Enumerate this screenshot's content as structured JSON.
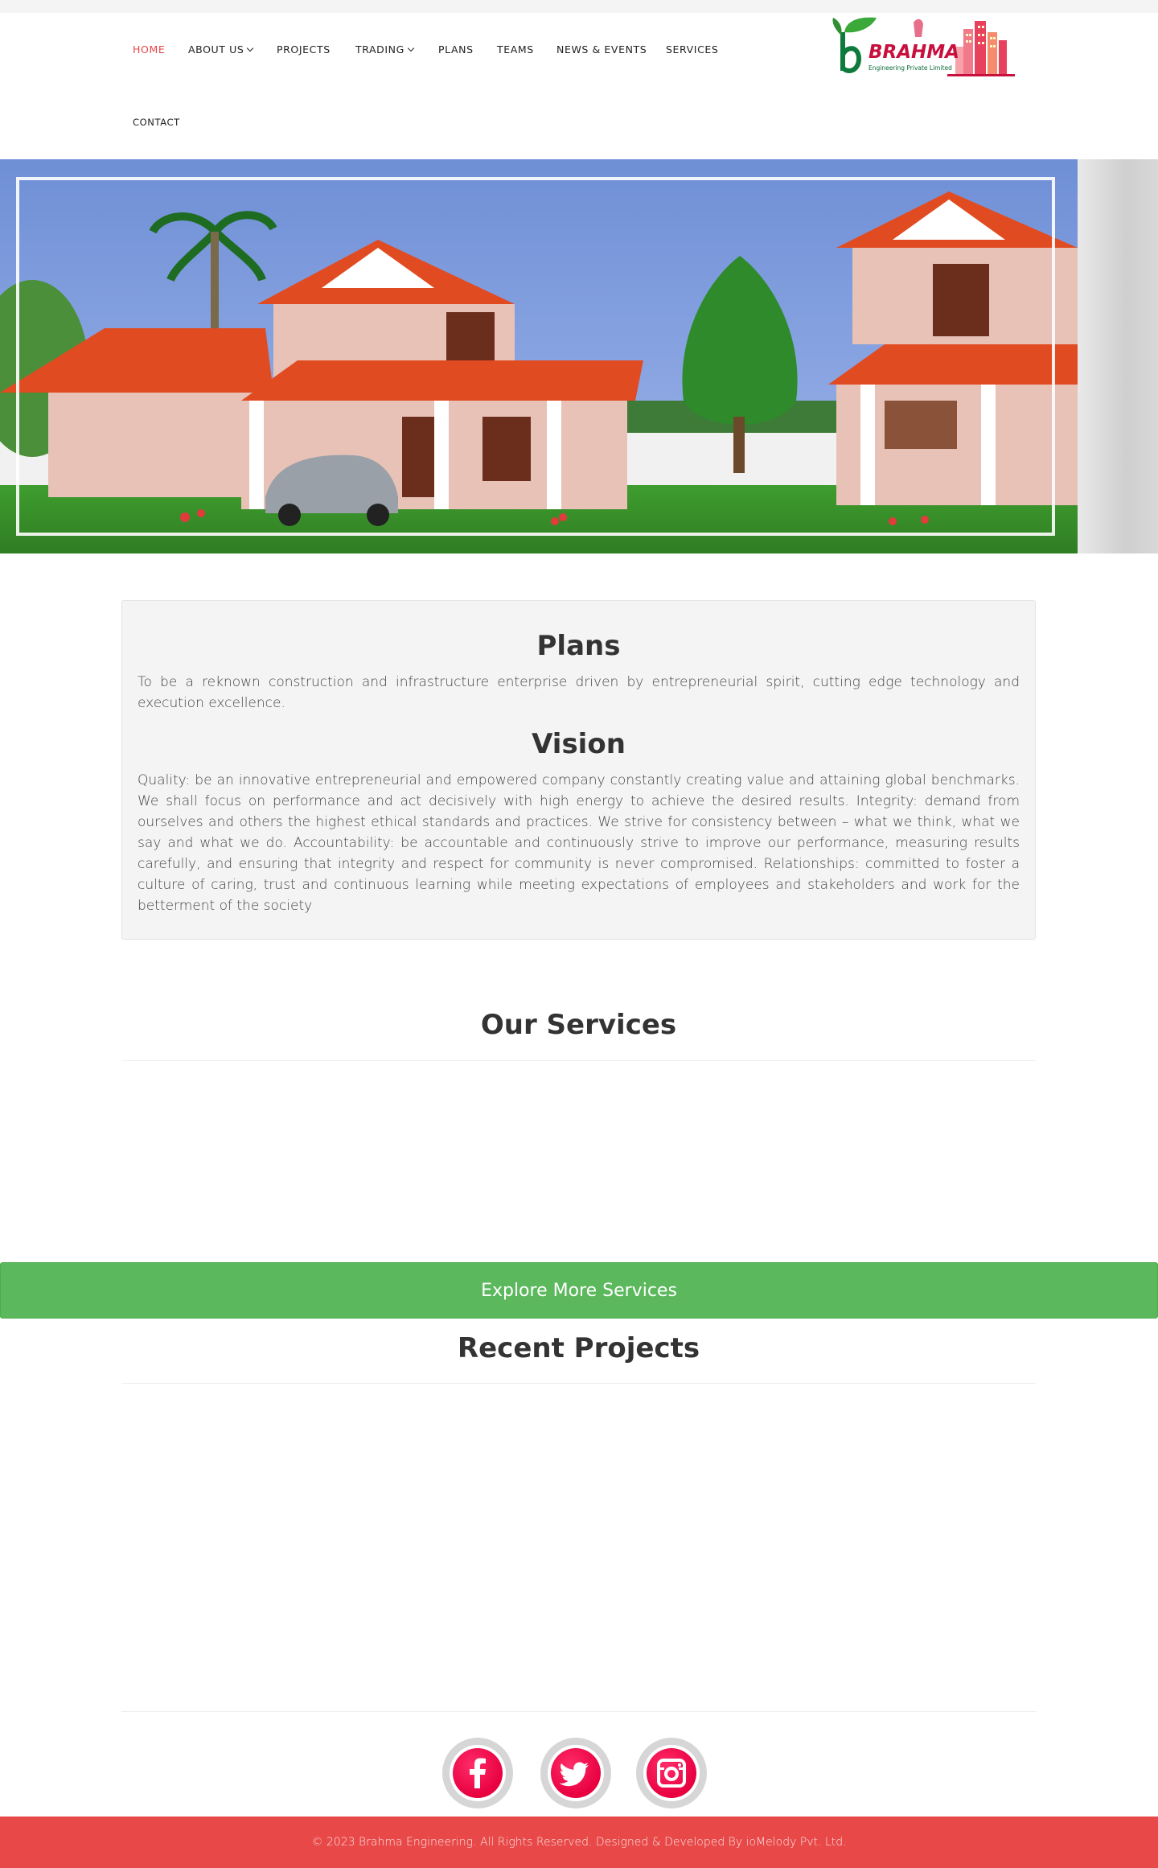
{
  "nav": {
    "items": [
      {
        "label": "HOME",
        "active": true
      },
      {
        "label": "ABOUT US",
        "dropdown": true
      },
      {
        "label": "PROJECTS"
      },
      {
        "label": "TRADING",
        "dropdown": true
      },
      {
        "label": "PLANS"
      },
      {
        "label": "TEAMS"
      },
      {
        "label": "NEWS & EVENTS"
      },
      {
        "label": "SERVICES"
      },
      {
        "label": "CONTACT"
      }
    ],
    "active_color": "#e84545"
  },
  "logo": {
    "name": "BRAHMA",
    "subtitle": "Engineering Private Limited"
  },
  "plans_box": {
    "plans_heading": "Plans",
    "plans_text": "To be a reknown construction and infrastructure enterprise driven by entrepreneurial spirit, cutting edge technology and execution excellence.",
    "vision_heading": "Vision",
    "vision_text": "Quality: be an innovative entrepreneurial and empowered company constantly creating value and attaining global benchmarks. We shall focus on performance and act decisively with high energy to achieve the desired results. Integrity: demand from ourselves and others the highest ethical standards and practices. We strive for consistency between – what we think, what we say and what we do. Accountability: be accountable and continuously strive to improve our performance, measuring results carefully, and ensuring that integrity and respect for community is never compromised. Relationships: committed to foster a culture of caring, trust and continuous learning while meeting expectations of employees and stakeholders and work for the betterment of the society"
  },
  "services": {
    "title": "Our Services",
    "button_label": "Explore More Services",
    "button_color": "#5cb85c"
  },
  "projects": {
    "title": "Recent Projects"
  },
  "social": [
    {
      "icon": "facebook-icon"
    },
    {
      "icon": "twitter-icon"
    },
    {
      "icon": "instagram-icon"
    }
  ],
  "footer": {
    "text": "© 2023 Brahma Engineering. All Rights Reserved. Designed & Developed By ioMelody Pvt. Ltd.",
    "color": "#e84848"
  }
}
